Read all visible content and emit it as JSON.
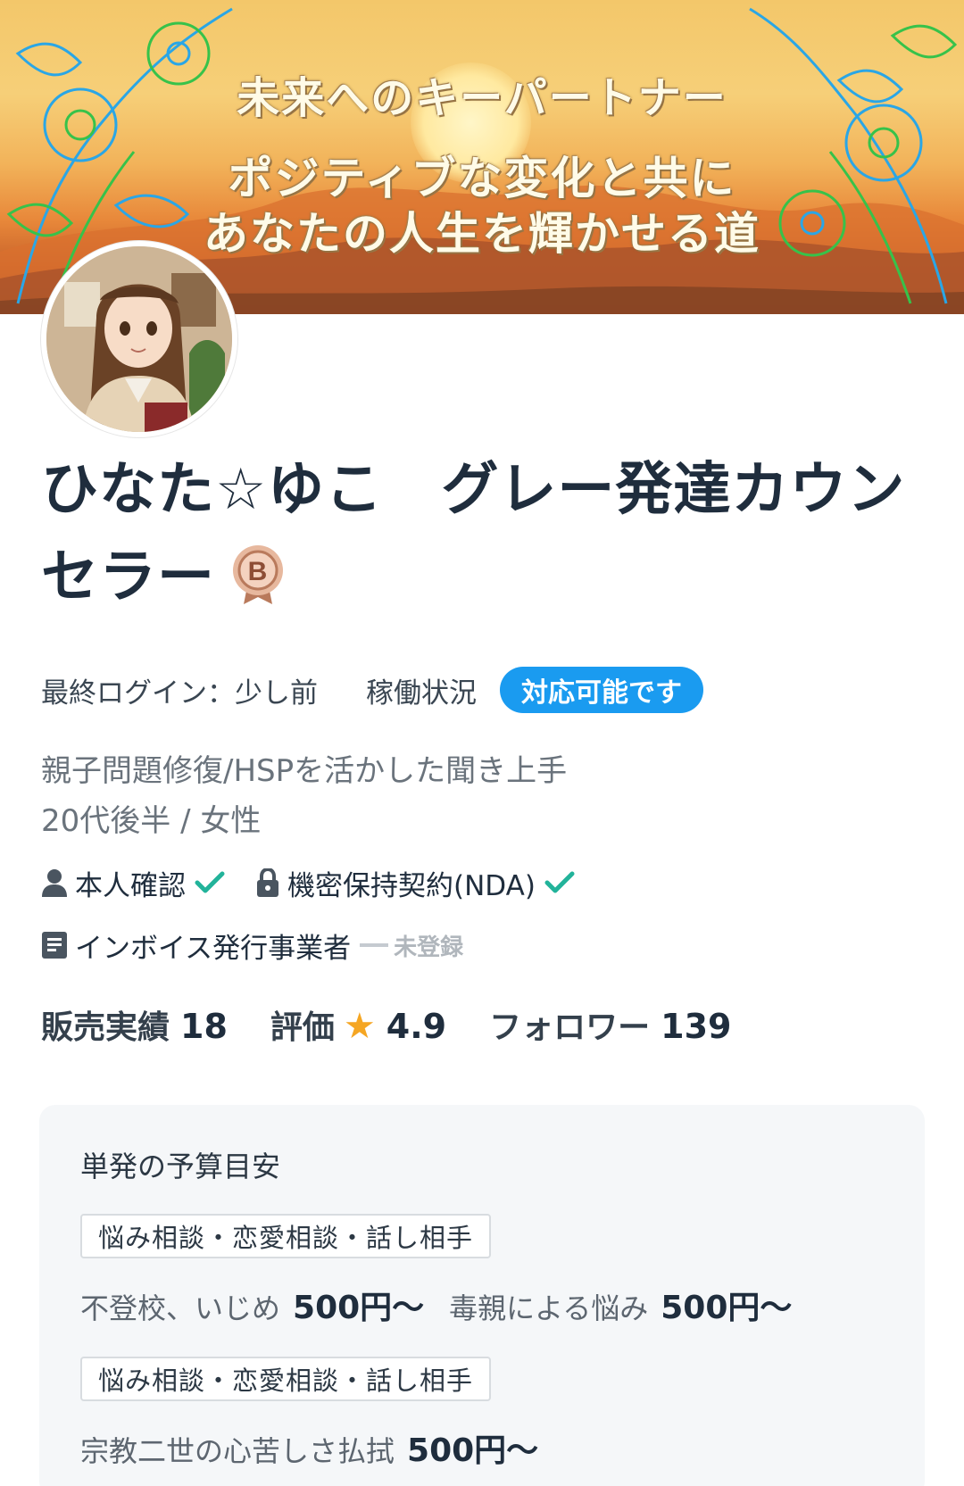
{
  "banner": {
    "line1": "未来へのキーパートナー",
    "line2": "ポジティブな変化と共に",
    "line3": "あなたの人生を輝かせる道"
  },
  "profile": {
    "name": "ひなた☆ゆこ　グレー発達カウンセラー",
    "rank_badge": "B",
    "last_login_label": "最終ログイン：少し前",
    "availability_label": "稼働状況",
    "availability_value": "対応可能です",
    "tagline": "親子問題修復/HSPを活かした聞き上手",
    "demographic": "20代後半 / 女性"
  },
  "verification": {
    "identity": "本人確認",
    "nda": "機密保持契約(NDA)",
    "invoice": "インボイス発行事業者",
    "invoice_status": "未登録"
  },
  "stats": {
    "sales_label": "販売実績",
    "sales_value": "18",
    "rating_label": "評価",
    "rating_value": "4.9",
    "followers_label": "フォロワー",
    "followers_value": "139"
  },
  "budget": {
    "title": "単発の予算目安",
    "groups": [
      {
        "category": "悩み相談・恋愛相談・話し相手",
        "items": [
          {
            "label": "不登校、いじめ",
            "price": "500円〜"
          },
          {
            "label": "毒親による悩み",
            "price": "500円〜"
          }
        ]
      },
      {
        "category": "悩み相談・恋愛相談・話し相手",
        "items": [
          {
            "label": "宗教二世の心苦しさ払拭",
            "price": "500円〜"
          }
        ]
      }
    ]
  },
  "colors": {
    "accent_blue": "#1a9bf0",
    "check_green": "#22b39a",
    "star_orange": "#f5a623",
    "badge_bronze": "#c98a6a"
  }
}
